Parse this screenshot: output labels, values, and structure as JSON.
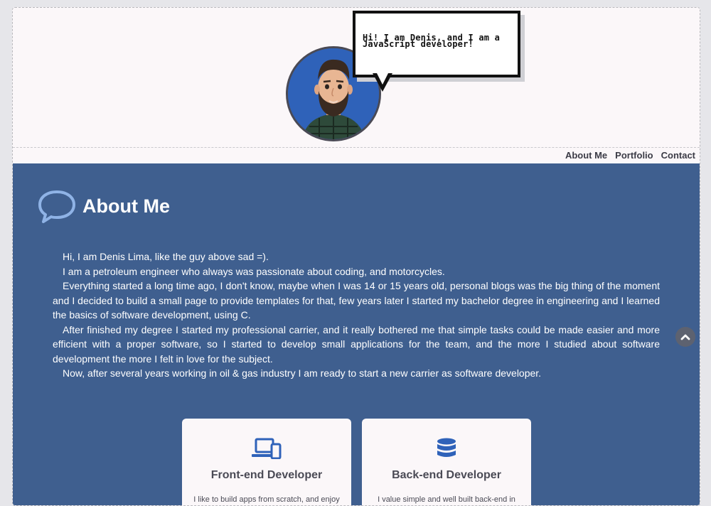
{
  "header": {
    "speech_bubble": "Hi! I am Denis, and I am a JavaScript developer!",
    "avatar_alt": "Denis avatar"
  },
  "nav": {
    "items": [
      "About Me",
      "Portfolio",
      "Contact"
    ]
  },
  "about": {
    "title": "About Me",
    "paragraphs": [
      "Hi, I am Denis Lima, like the guy above sad =).",
      "I am a petroleum engineer who always was passionate about coding, and motorcycles.",
      "Everything started a long time ago, I don't know, maybe when I was 14 or 15 years old, personal blogs was the big thing of the moment and I decided to build a small page to provide templates for that, few years later I started my bachelor degree in engineering and I learned the basics of software development, using C.",
      "After finished my degree I started my professional carrier, and it really bothered me that simple tasks could be made easier and more efficient with a proper software, so I started to develop small applications for the team, and the more I studied about software development the more I felt in love for the subject.",
      "Now, after several years working in oil & gas industry I am ready to start a new carrier as software developer."
    ]
  },
  "cards": [
    {
      "title": "Front-end Developer",
      "desc": "I like to build apps from scratch, and enjoy",
      "icon": "devices-icon"
    },
    {
      "title": "Back-end Developer",
      "desc": "I value simple and well built back-end in",
      "icon": "database-icon"
    }
  ],
  "colors": {
    "about_bg": "#3f5f8f",
    "header_bg": "#fbf7f9",
    "accent_blue": "#2f62b9"
  }
}
